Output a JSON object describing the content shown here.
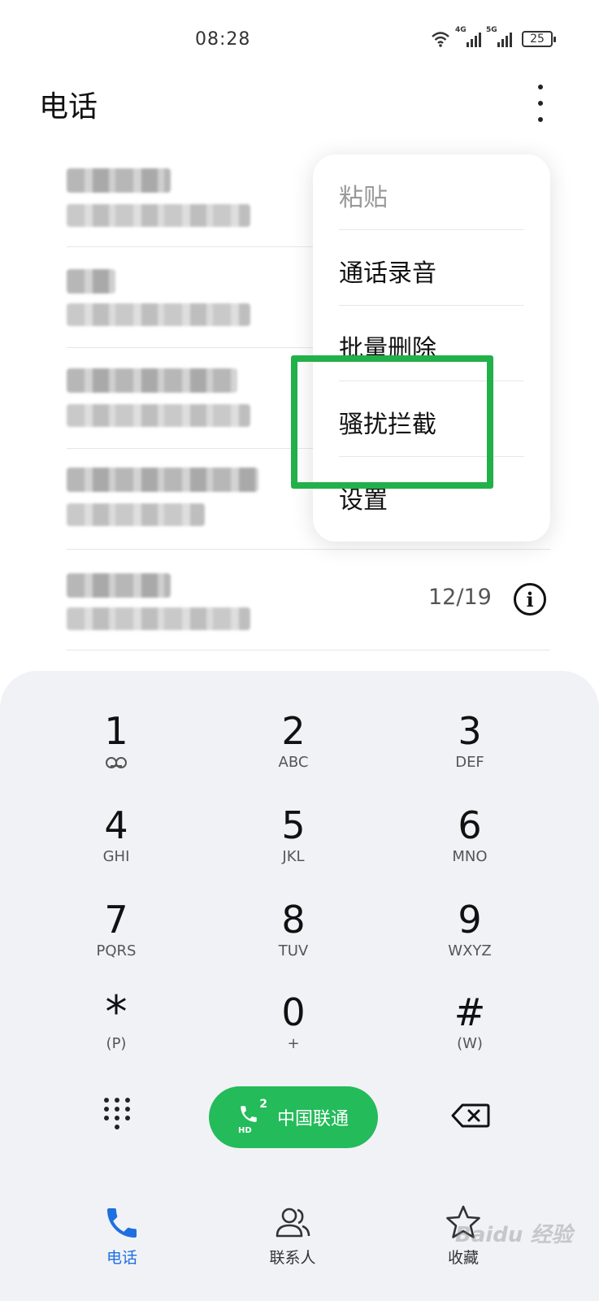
{
  "status_bar": {
    "time": "08:28",
    "network_1": "4G",
    "network_2": "5G",
    "battery": "25"
  },
  "header": {
    "title": "电话"
  },
  "call_log": {
    "visible_date": "12/19"
  },
  "popup_menu": {
    "items": [
      {
        "label": "粘贴",
        "enabled": false
      },
      {
        "label": "通话录音",
        "enabled": true
      },
      {
        "label": "批量删除",
        "enabled": true
      },
      {
        "label": "骚扰拦截",
        "enabled": true,
        "highlighted": true
      },
      {
        "label": "设置",
        "enabled": true
      }
    ],
    "highlight_color": "#22b04a"
  },
  "dialpad": {
    "keys": [
      {
        "digit": "1",
        "sub": ""
      },
      {
        "digit": "2",
        "sub": "ABC"
      },
      {
        "digit": "3",
        "sub": "DEF"
      },
      {
        "digit": "4",
        "sub": "GHI"
      },
      {
        "digit": "5",
        "sub": "JKL"
      },
      {
        "digit": "6",
        "sub": "MNO"
      },
      {
        "digit": "7",
        "sub": "PQRS"
      },
      {
        "digit": "8",
        "sub": "TUV"
      },
      {
        "digit": "9",
        "sub": "WXYZ"
      },
      {
        "digit": "*",
        "sub": "(P)"
      },
      {
        "digit": "0",
        "sub": "+"
      },
      {
        "digit": "#",
        "sub": "(W)"
      }
    ],
    "call_button": {
      "label": "中国联通",
      "sim": "2",
      "hd": "HD",
      "color": "#24bb5a"
    }
  },
  "bottom_nav": {
    "items": [
      {
        "label": "电话",
        "icon": "phone-icon",
        "active": true
      },
      {
        "label": "联系人",
        "icon": "contacts-icon",
        "active": false
      },
      {
        "label": "收藏",
        "icon": "star-icon",
        "active": false
      }
    ],
    "active_color": "#1e6fe0"
  },
  "watermark": "Baidu 经验"
}
